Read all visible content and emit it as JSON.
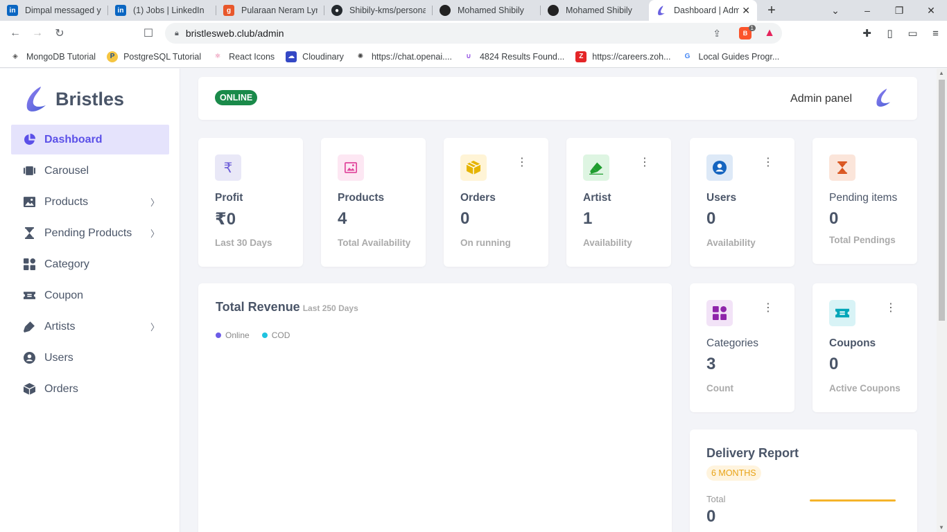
{
  "browser": {
    "tabs": [
      {
        "title": "Dimpal messaged you",
        "icon": "linkedin-icon",
        "active": false
      },
      {
        "title": "(1) Jobs | LinkedIn",
        "icon": "linkedin-icon",
        "active": false
      },
      {
        "title": "Pularaan Neram Lyrics",
        "icon": "g-icon",
        "active": false
      },
      {
        "title": "Shibily-kms/personal-",
        "icon": "github-icon",
        "active": false
      },
      {
        "title": "Mohamed Shibily",
        "icon": "avatar-icon",
        "active": false
      },
      {
        "title": "Mohamed Shibily",
        "icon": "avatar-icon",
        "active": false
      },
      {
        "title": "Dashboard | Admi",
        "icon": "bristles-icon",
        "active": true
      }
    ],
    "url": "bristlesweb.club/admin",
    "brave_badge": "1",
    "bookmarks": [
      {
        "label": "MongoDB Tutorial",
        "icon": "mongodb-icon"
      },
      {
        "label": "PostgreSQL Tutorial",
        "icon": "postgres-icon"
      },
      {
        "label": "React Icons",
        "icon": "react-icon"
      },
      {
        "label": "Cloudinary",
        "icon": "cloudinary-icon"
      },
      {
        "label": "https://chat.openai....",
        "icon": "openai-icon"
      },
      {
        "label": "4824 Results Found...",
        "icon": "wave-icon"
      },
      {
        "label": "https://careers.zoh...",
        "icon": "zoho-icon"
      },
      {
        "label": "Local Guides Progr...",
        "icon": "google-icon"
      }
    ]
  },
  "sidebar": {
    "brand": "Bristles",
    "items": [
      {
        "label": "Dashboard",
        "icon": "pie-chart-icon",
        "active": true,
        "has_children": false
      },
      {
        "label": "Carousel",
        "icon": "carousel-icon",
        "active": false,
        "has_children": false
      },
      {
        "label": "Products",
        "icon": "image-icon",
        "active": false,
        "has_children": true
      },
      {
        "label": "Pending Products",
        "icon": "hourglass-icon",
        "active": false,
        "has_children": true
      },
      {
        "label": "Category",
        "icon": "grid-icon",
        "active": false,
        "has_children": false
      },
      {
        "label": "Coupon",
        "icon": "ticket-icon",
        "active": false,
        "has_children": false
      },
      {
        "label": "Artists",
        "icon": "brush-icon",
        "active": false,
        "has_children": true
      },
      {
        "label": "Users",
        "icon": "user-circle-icon",
        "active": false,
        "has_children": false
      },
      {
        "label": "Orders",
        "icon": "box-icon",
        "active": false,
        "has_children": false
      }
    ]
  },
  "header": {
    "status": "ONLINE",
    "title": "Admin panel"
  },
  "stats": [
    {
      "title": "Profit",
      "value": "₹0",
      "sub": "Last 30 Days",
      "icon": "rupee-icon",
      "icon_color": "#6d5ed8",
      "icon_bg": "#e9e8f7",
      "menu": false
    },
    {
      "title": "Products",
      "value": "4",
      "sub": "Total Availability",
      "icon": "image-icon",
      "icon_color": "#e0449b",
      "icon_bg": "#fde7f3",
      "menu": false
    },
    {
      "title": "Orders",
      "value": "0",
      "sub": "On running",
      "icon": "package-icon",
      "icon_color": "#e6b400",
      "icon_bg": "#fff4d6",
      "menu": true
    },
    {
      "title": "Artist",
      "value": "1",
      "sub": "Availability",
      "icon": "brush-icon",
      "icon_color": "#1f9d2f",
      "icon_bg": "#def5e2",
      "menu": true
    },
    {
      "title": "Users",
      "value": "0",
      "sub": "Availability",
      "icon": "user-circle-icon",
      "icon_color": "#1565c0",
      "icon_bg": "#dde9f7",
      "menu": true
    },
    {
      "title": "Pending items",
      "value": "0",
      "sub": "Total Pendings",
      "icon": "hourglass-icon",
      "icon_color": "#d9541e",
      "icon_bg": "#fbe5da",
      "menu": false
    }
  ],
  "revenue": {
    "title": "Total Revenue",
    "subtitle": "Last 250 Days",
    "legend": [
      {
        "name": "Online",
        "color": "#6c5ce7"
      },
      {
        "name": "COD",
        "color": "#1fc3e0"
      }
    ]
  },
  "small_stats": [
    {
      "title": "Categories",
      "value": "3",
      "sub": "Count",
      "icon": "grid-icon",
      "icon_color": "#8e24aa",
      "icon_bg": "#f2e3f7",
      "menu": true
    },
    {
      "title": "Coupons",
      "value": "0",
      "sub": "Active Coupons",
      "icon": "ticket-icon",
      "icon_color": "#00a6b8",
      "icon_bg": "#d8f3f6",
      "menu": true
    }
  ],
  "delivery": {
    "title": "Delivery Report",
    "period": "6 MONTHS",
    "total_label": "Total",
    "total_value": "0",
    "line_color": "#f5b42a"
  }
}
